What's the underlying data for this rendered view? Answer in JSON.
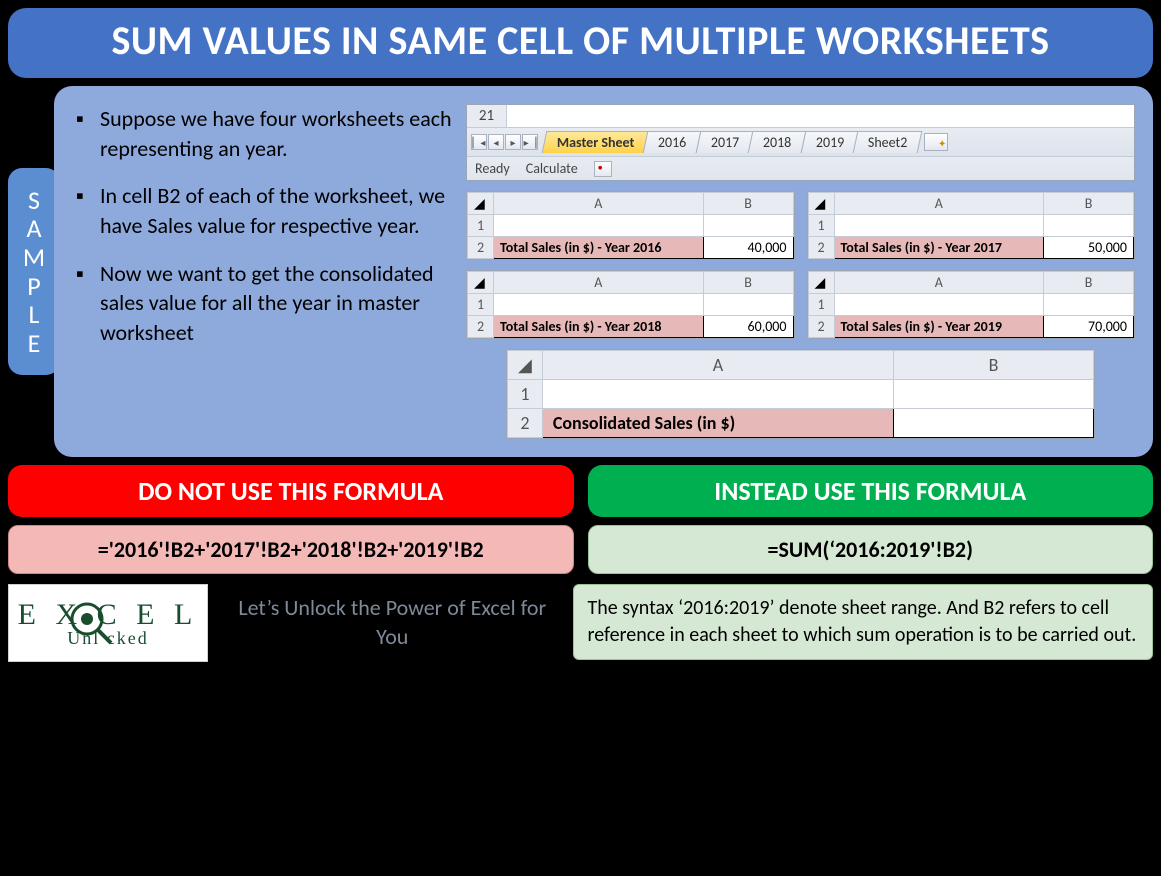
{
  "title": "SUM VALUES IN SAME CELL OF MULTIPLE WORKSHEETS",
  "sample_label": "SAMPLE",
  "bullets": [
    "Suppose we have four worksheets each representing an year.",
    "In cell B2 of each of the worksheet, we have Sales value for respective year.",
    "Now we want to get the consolidated sales value for all the year in master worksheet"
  ],
  "tabstrip": {
    "rownum": "21",
    "tabs": [
      "Master Sheet",
      "2016",
      "2017",
      "2018",
      "2019",
      "Sheet2"
    ],
    "active": "Master Sheet",
    "status": [
      "Ready",
      "Calculate"
    ]
  },
  "mini_sheets": [
    {
      "label": "Total Sales (in $) - Year 2016",
      "value": "40,000"
    },
    {
      "label": "Total Sales (in $) - Year 2017",
      "value": "50,000"
    },
    {
      "label": "Total Sales (in $) - Year 2018",
      "value": "60,000"
    },
    {
      "label": "Total Sales (in $) - Year 2019",
      "value": "70,000"
    }
  ],
  "cols": {
    "A": "A",
    "B": "B"
  },
  "rows": {
    "r1": "1",
    "r2": "2"
  },
  "consolidated_label": "Consolidated Sales (in $)",
  "dont_heading": "DO NOT USE THIS FORMULA",
  "use_heading": "INSTEAD USE THIS FORMULA",
  "bad_formula": "='2016'!B2+'2017'!B2+'2018'!B2+'2019'!B2",
  "good_formula": "=SUM(‘'2016:2019'!B2)",
  "good_formula_display": "=SUM(‘2016:2019'!B2)",
  "logo": {
    "top": "E X C   E L",
    "bottom": "Unl   cked"
  },
  "tagline": "Let’s Unlock the Power of Excel for You",
  "explain": "The syntax ‘2016:2019’ denote sheet range. And B2 refers to cell reference in each sheet to which sum operation is to be carried out."
}
